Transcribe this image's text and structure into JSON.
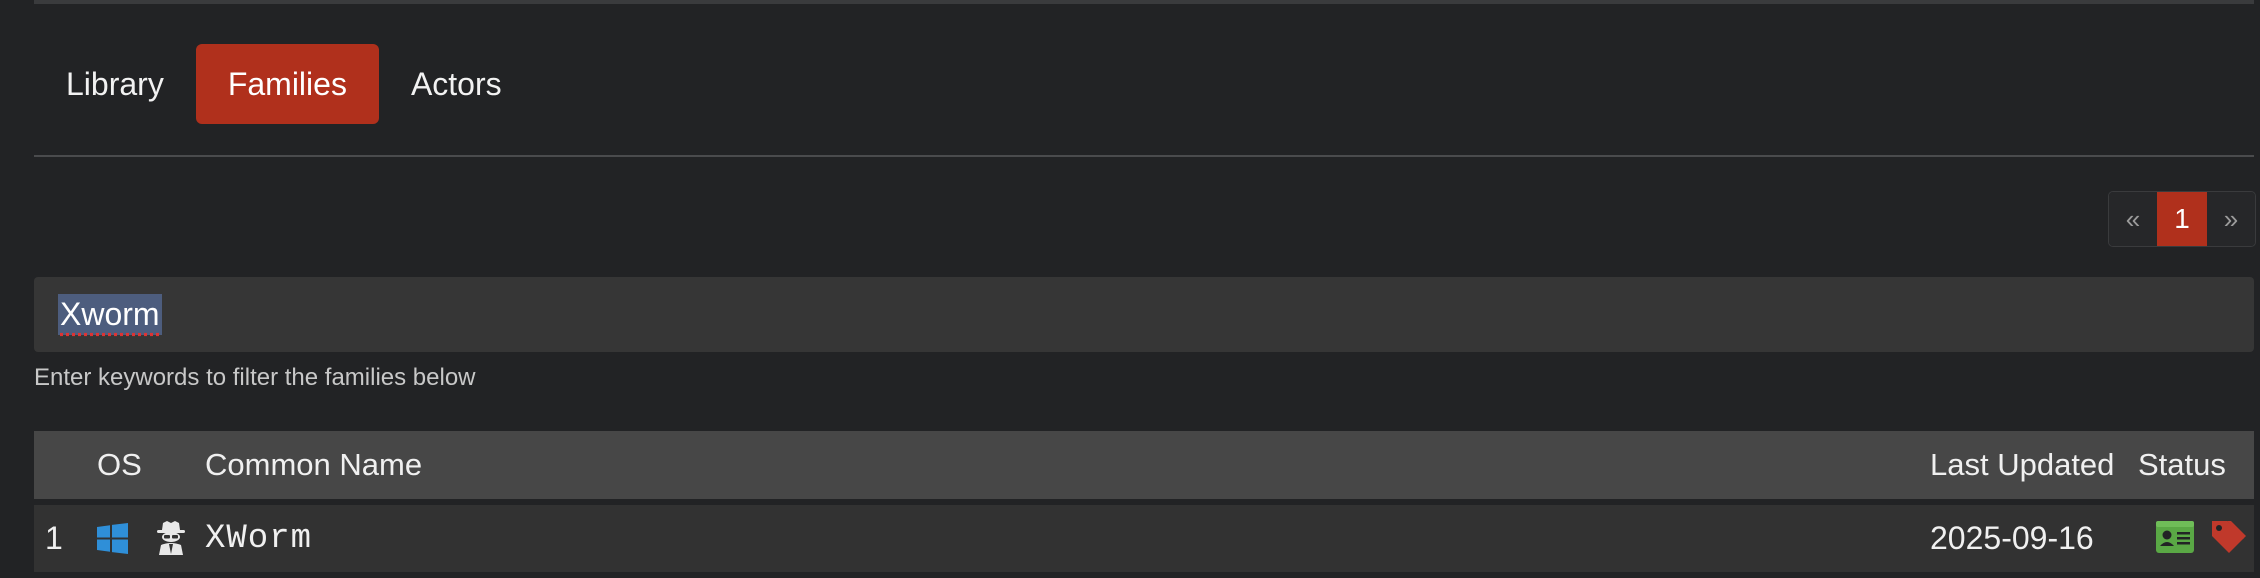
{
  "tabs": [
    {
      "label": "Library",
      "active": false
    },
    {
      "label": "Families",
      "active": true
    },
    {
      "label": "Actors",
      "active": false
    }
  ],
  "pagination": {
    "prev": "«",
    "current": "1",
    "next": "»"
  },
  "search": {
    "value": "Xworm",
    "help": "Enter keywords to filter the families below"
  },
  "table": {
    "headers": {
      "num": "",
      "os": "OS",
      "common_name": "Common Name",
      "last_updated": "Last Updated",
      "status": "Status"
    },
    "rows": [
      {
        "num": "1",
        "os_icon": "windows-icon",
        "type_icon": "spy-icon",
        "common_name": "XWorm",
        "last_updated": "2025-09-16",
        "status_icons": [
          "id-card-icon",
          "tag-icon"
        ]
      }
    ]
  },
  "colors": {
    "accent": "#b0301c",
    "background": "#222325",
    "windows_blue": "#2f8fd8",
    "status_green": "#5aa845",
    "status_red": "#c0392b"
  }
}
